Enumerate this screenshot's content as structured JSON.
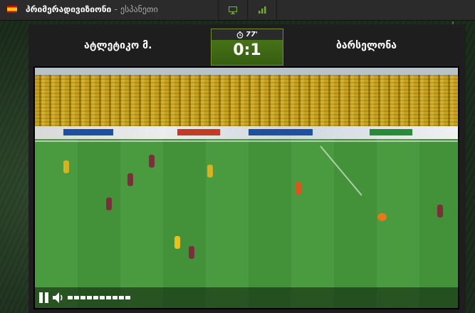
{
  "header": {
    "league": "პრიმერადივიზიონი",
    "separator": "-",
    "country": "ესპანეთი",
    "flag_icon": "spain-flag-icon",
    "buttons": [
      {
        "icon": "tv-icon"
      },
      {
        "icon": "bar-chart-icon"
      }
    ]
  },
  "match": {
    "home_team": "ატლეტიკო მ.",
    "away_team": "ბარსელონა",
    "minute": "77'",
    "clock_icon": "clock-icon",
    "score": "0:1"
  },
  "player_controls": {
    "pause_icon": "pause-icon",
    "volume_icon": "speaker-icon",
    "volume_level": 1.0
  },
  "colors": {
    "accent_green": "#4f7a1a",
    "topbar": "#2b2b2b",
    "panel": "#1e1e1e"
  }
}
